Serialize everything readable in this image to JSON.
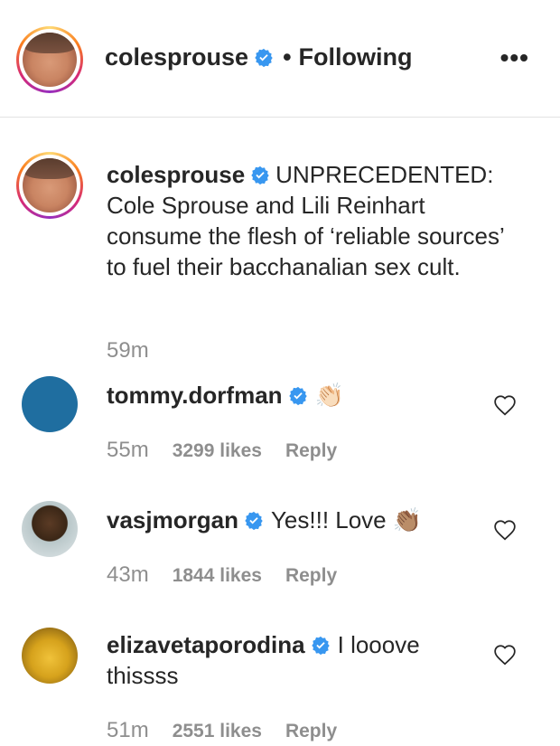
{
  "header": {
    "username": "colesprouse",
    "separator": "•",
    "follow_status": "Following",
    "more_label": "•••"
  },
  "caption": {
    "username": "colesprouse",
    "text": "UNPRECEDENTED: Cole Sprouse and Lili Reinhart consume the flesh of ‘reliable sources’ to fuel their bacchanalian sex cult.",
    "time": "59m"
  },
  "comments": [
    {
      "username": "tommy.dorfman",
      "text": "",
      "emoji": "👏🏻",
      "time": "55m",
      "likes": "3299 likes",
      "reply": "Reply",
      "avatar_color": "#1f6ea0"
    },
    {
      "username": "vasjmorgan",
      "text": "Yes!!! Love",
      "emoji": "👏🏽",
      "time": "43m",
      "likes": "1844 likes",
      "reply": "Reply",
      "avatar_color": "#8a6a4a"
    },
    {
      "username": "elizavetaporodina",
      "text": "I looove thissss",
      "emoji": "",
      "time": "51m",
      "likes": "2551 likes",
      "reply": "Reply",
      "avatar_color": "#d6a21c"
    }
  ],
  "colors": {
    "verified": "#3897f0",
    "muted": "#8e8e8e",
    "text": "#262626"
  }
}
